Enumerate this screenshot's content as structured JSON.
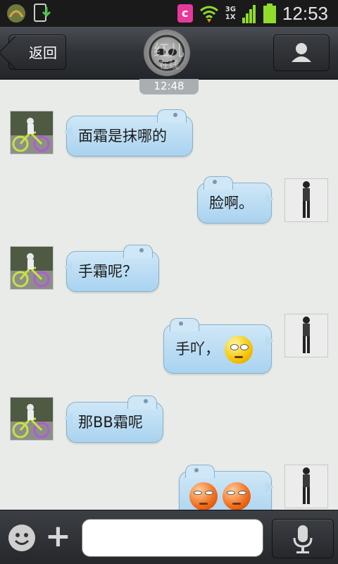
{
  "status_bar": {
    "time": "12:53",
    "network_label_top": "3G",
    "network_label_bottom": "1X",
    "app_badge": "c"
  },
  "header": {
    "back_label": "返回",
    "title": "红儿",
    "subtitle": "在线"
  },
  "timestamp": "12:48",
  "messages": [
    {
      "side": "left",
      "text": "面霜是抹哪的"
    },
    {
      "side": "right",
      "text": "脸啊。"
    },
    {
      "side": "left",
      "text": "手霜呢？"
    },
    {
      "side": "right",
      "text": "手吖，"
    },
    {
      "side": "left",
      "text": "那BB霜呢"
    },
    {
      "side": "right",
      "text": ""
    }
  ],
  "input": {
    "placeholder": ""
  },
  "icons": {
    "status_left": [
      "app-icon",
      "download-icon"
    ],
    "status_right": [
      "c-app-icon",
      "wifi-icon",
      "signal-icon",
      "battery-icon"
    ],
    "bottom": [
      "smiley-icon",
      "plus-icon",
      "mic-icon"
    ]
  },
  "colors": {
    "bubble": "#b9dcf3",
    "background": "#e8ebe8",
    "titlebar": "#2f3237"
  }
}
